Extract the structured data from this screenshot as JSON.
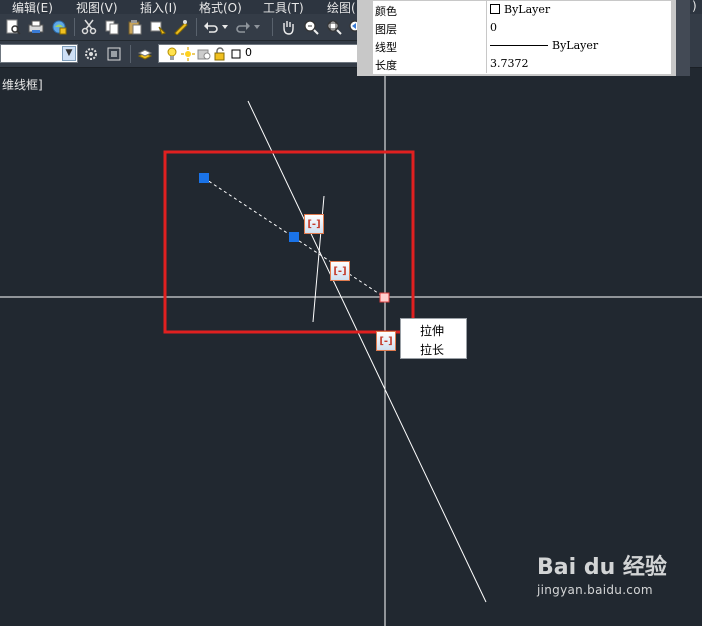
{
  "menubar": {
    "items": [
      "编辑(E)",
      "视图(V)",
      "插入(I)",
      "格式(O)",
      "工具(T)",
      "绘图(",
      ")"
    ]
  },
  "toolbar2": {
    "layer_name": "0"
  },
  "viewport": {
    "label": "维线框]"
  },
  "properties": {
    "rows": [
      {
        "name": "颜色",
        "value": "ByLayer"
      },
      {
        "name": "图层",
        "value": "0"
      },
      {
        "name": "线型",
        "value": "ByLayer"
      },
      {
        "name": "长度",
        "value": "3.7372"
      }
    ]
  },
  "grips": {
    "hot_grip_icon": "[-]",
    "grip_color": "#1a73e8",
    "selection_color": "#e02020"
  },
  "context_menu": {
    "items": [
      "拉伸",
      "拉长"
    ]
  },
  "watermark": {
    "logo": "Bai du 经验",
    "url": "jingyan.baidu.com"
  },
  "icons": [
    "preview-icon",
    "plot-icon",
    "publish-icon",
    "cut-icon",
    "copy-icon",
    "paste-icon",
    "matchprop-icon",
    "undo-icon",
    "redo-icon",
    "pan-icon",
    "zoom-icon",
    "gear-icon",
    "layer-icon",
    "bulb-icon",
    "sun-icon",
    "lock-icon",
    "color-swatch-icon"
  ]
}
